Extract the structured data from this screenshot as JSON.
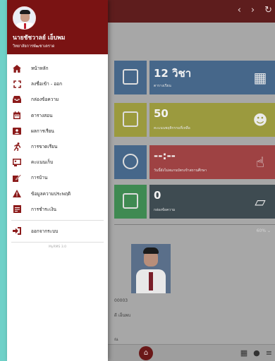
{
  "app": {
    "top_icons": [
      "‹",
      "›",
      "↻"
    ],
    "tiles": [
      {
        "big": "12 วิชา",
        "small": "ตารางเรียน",
        "color": "#46678a"
      },
      {
        "big": "50",
        "small": "คะแนนพฤติกรรมที่เหลือ",
        "color": "#9b9a3e"
      },
      {
        "big": "--:--",
        "small": "วันนี้ยังไม่สแกนบัตรเข้าสถานศึกษา",
        "color": "#9e4243"
      },
      {
        "big": "0",
        "small": "กล่องข้อความ",
        "color": "#3e4b51"
      }
    ],
    "zoom": "60% ⌄",
    "info_lines": [
      "00003",
      "ดี เอ็นพบ",
      "ณ"
    ]
  },
  "drawer": {
    "user_name": "นายชัชวาลย์ เอ็บพม",
    "user_sub": "วิทยาลัยการพัฒชาเตราด",
    "items": [
      {
        "label": "หน้าหลัก",
        "icon": "home-icon",
        "color": "#8b1a1a"
      },
      {
        "label": "ลงชื่อเข้า - ออก",
        "icon": "scan-icon",
        "color": "#8b1a1a"
      },
      {
        "label": "กล่องข้อความ",
        "icon": "inbox-icon",
        "color": "#8b1a1a"
      },
      {
        "label": "ตารางสอน",
        "icon": "calendar-icon",
        "color": "#8b1a1a"
      },
      {
        "label": "ผลการเรียน",
        "icon": "id-card-icon",
        "color": "#8b1a1a"
      },
      {
        "label": "การขาดเรียน",
        "icon": "running-icon",
        "color": "#8b1a1a"
      },
      {
        "label": "คะแนนเก็บ",
        "icon": "clipboard-user-icon",
        "color": "#8b1a1a"
      },
      {
        "label": "การบ้าน",
        "icon": "edit-icon",
        "color": "#8b1a1a"
      },
      {
        "label": "ข้อมูลความประพฤติ",
        "icon": "warning-icon",
        "color": "#8b1a1a"
      },
      {
        "label": "การชำระเงิน",
        "icon": "payment-icon",
        "color": "#8b1a1a"
      }
    ],
    "logout_label": "ออกจากระบบ",
    "version": "MyRMS 3.0"
  }
}
